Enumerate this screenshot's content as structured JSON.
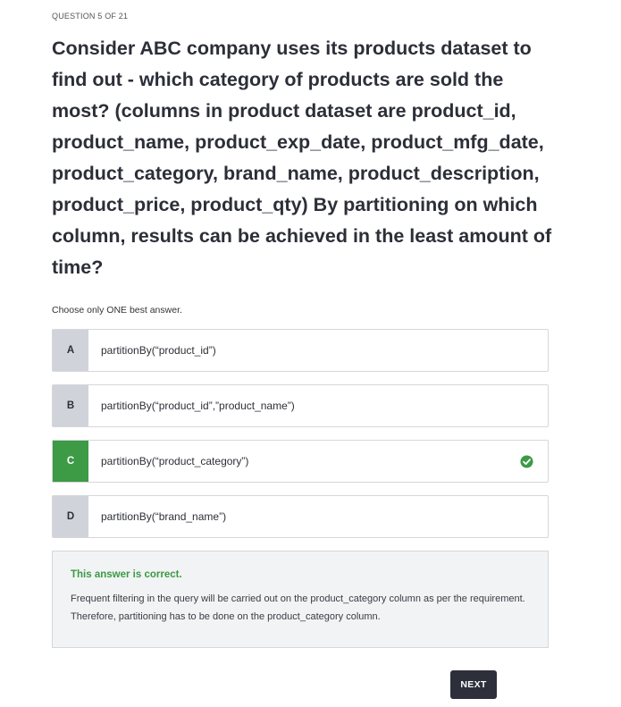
{
  "header": {
    "counter": "QUESTION 5 OF 21"
  },
  "question": {
    "text": "Consider ABC company uses its products dataset to find out - which category of products are sold the most? (columns in product dataset are product_id, product_name, product_exp_date, product_mfg_date, product_category, brand_name, product_description, product_price, product_qty) By partitioning on which column, results can be achieved in the least amount of time?"
  },
  "instruction": "Choose only ONE best answer.",
  "options": [
    {
      "letter": "A",
      "text": "partitionBy(“product_id”)"
    },
    {
      "letter": "B",
      "text": "partitionBy(“product_id”,”product_name”)"
    },
    {
      "letter": "C",
      "text": "partitionBy(“product_category”)"
    },
    {
      "letter": "D",
      "text": "partitionBy(“brand_name”)"
    }
  ],
  "selected_option": "C",
  "feedback": {
    "title": "This answer is correct.",
    "body": "Frequent filtering in the query will be carried out on the product_category column as per the requirement. Therefore, partitioning has to be done on the product_category column."
  },
  "actions": {
    "next_label": "NEXT"
  },
  "colors": {
    "correct_green": "#3d9a45",
    "letter_bg": "#d1d3db",
    "button_dark": "#2d2f3b",
    "feedback_bg": "#f2f3f5"
  },
  "icons": {
    "correct_indicator": "check-circle-icon"
  }
}
